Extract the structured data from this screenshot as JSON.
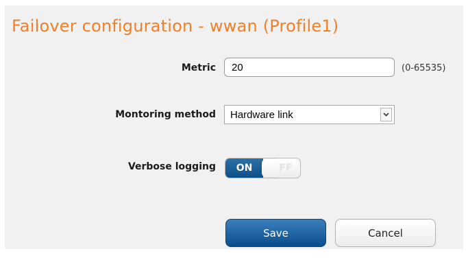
{
  "page": {
    "title": "Failover configuration - wwan (Profile1)"
  },
  "form": {
    "metric": {
      "label": "Metric",
      "value": "20",
      "range_hint": "(0-65535)"
    },
    "monitoring_method": {
      "label": "Montoring method",
      "selected": "Hardware link"
    },
    "verbose_logging": {
      "label": "Verbose logging",
      "on_label": "ON",
      "off_label": "OFF",
      "state": "on"
    }
  },
  "actions": {
    "save_label": "Save",
    "cancel_label": "Cancel"
  },
  "colors": {
    "title": "#f0812a",
    "primary": "#0b4d8c",
    "panel_background": "#f1f1f1"
  },
  "icons": {
    "select_arrow": "chevron-down-icon"
  }
}
